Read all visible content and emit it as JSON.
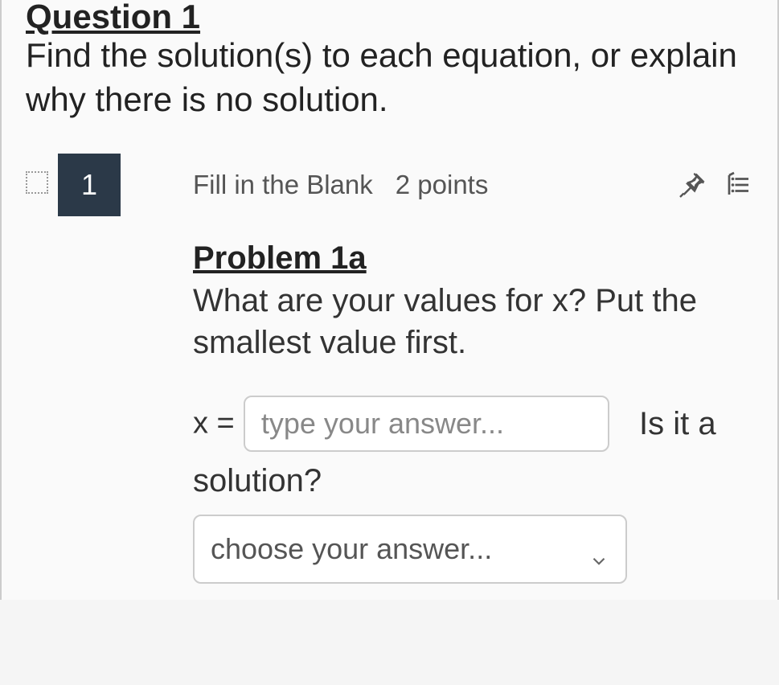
{
  "question": {
    "title": "Question 1",
    "prompt": "Find the solution(s) to each equation, or explain why there is no solution."
  },
  "item": {
    "number": "1",
    "type_label": "Fill in the Blank",
    "points_label": "2 points"
  },
  "problem": {
    "heading": "Problem 1a",
    "text": "What are your values for x? Put the smallest value first."
  },
  "answer": {
    "x_label": "x =",
    "input_placeholder": "type your answer...",
    "after_input": "Is it a",
    "solution_label": "solution?",
    "dropdown_placeholder": "choose your answer..."
  }
}
